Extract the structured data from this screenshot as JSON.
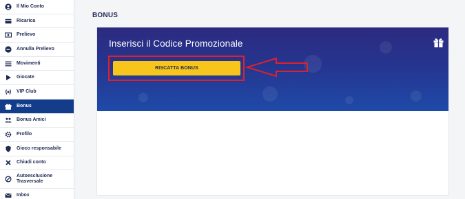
{
  "sidebar": {
    "items": [
      {
        "label": "Il Mio Conto",
        "icon": "user-circle-icon"
      },
      {
        "label": "Ricarica",
        "icon": "credit-card-icon"
      },
      {
        "label": "Prelievo",
        "icon": "money-bill-icon"
      },
      {
        "label": "Annulla Prelievo",
        "icon": "minus-circle-icon"
      },
      {
        "label": "Movimenti",
        "icon": "list-icon"
      },
      {
        "label": "Giocate",
        "icon": "play-icon"
      },
      {
        "label": "VIP Club",
        "icon": "laurel-icon"
      },
      {
        "label": "Bonus",
        "icon": "gift-icon",
        "active": true
      },
      {
        "label": "Bonus Amici",
        "icon": "users-icon"
      },
      {
        "label": "Profilo",
        "icon": "gear-icon"
      },
      {
        "label": "Gioco responsabile",
        "icon": "shield-icon"
      },
      {
        "label": "Chiudi conto",
        "icon": "x-icon"
      },
      {
        "label": "Autoesclusione Trasversale",
        "icon": "ban-icon"
      },
      {
        "label": "Inbox",
        "icon": "envelope-icon"
      }
    ]
  },
  "main": {
    "title": "BONUS",
    "banner": {
      "title": "Inserisci il Codice Promozionale",
      "button_label": "RISCATTA BONUS"
    }
  },
  "colors": {
    "sidebar_active": "#133c8b",
    "banner_top": "#2c2a80",
    "banner_bottom": "#1f4aa8",
    "button": "#f7c51b",
    "highlight": "#e3202a",
    "text_dark": "#1e2a52"
  }
}
